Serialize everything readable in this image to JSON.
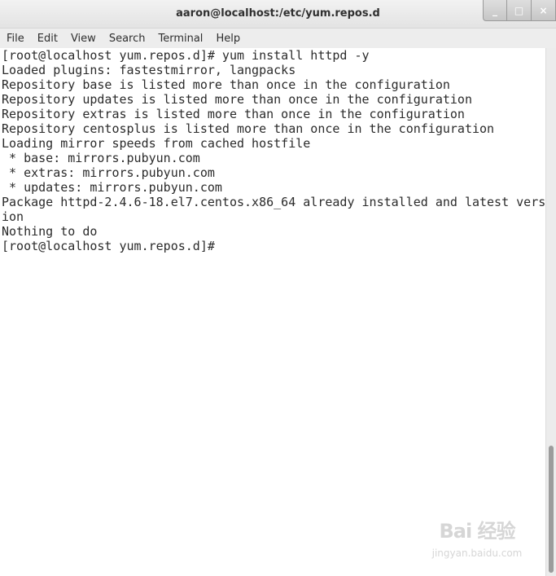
{
  "window": {
    "title": "aaron@localhost:/etc/yum.repos.d",
    "controls": {
      "minimize": "_",
      "maximize": "□",
      "close": "×"
    }
  },
  "menu": [
    "File",
    "Edit",
    "View",
    "Search",
    "Terminal",
    "Help"
  ],
  "terminal": {
    "lines": [
      "[root@localhost yum.repos.d]# yum install httpd -y",
      "Loaded plugins: fastestmirror, langpacks",
      "Repository base is listed more than once in the configuration",
      "Repository updates is listed more than once in the configuration",
      "Repository extras is listed more than once in the configuration",
      "Repository centosplus is listed more than once in the configuration",
      "Loading mirror speeds from cached hostfile",
      " * base: mirrors.pubyun.com",
      " * extras: mirrors.pubyun.com",
      " * updates: mirrors.pubyun.com",
      "Package httpd-2.4.6-18.el7.centos.x86_64 already installed and latest vers",
      "ion",
      "Nothing to do",
      "[root@localhost yum.repos.d]#"
    ]
  },
  "watermark": {
    "main": "Bai 经验",
    "sub": "jingyan.baidu.com"
  }
}
